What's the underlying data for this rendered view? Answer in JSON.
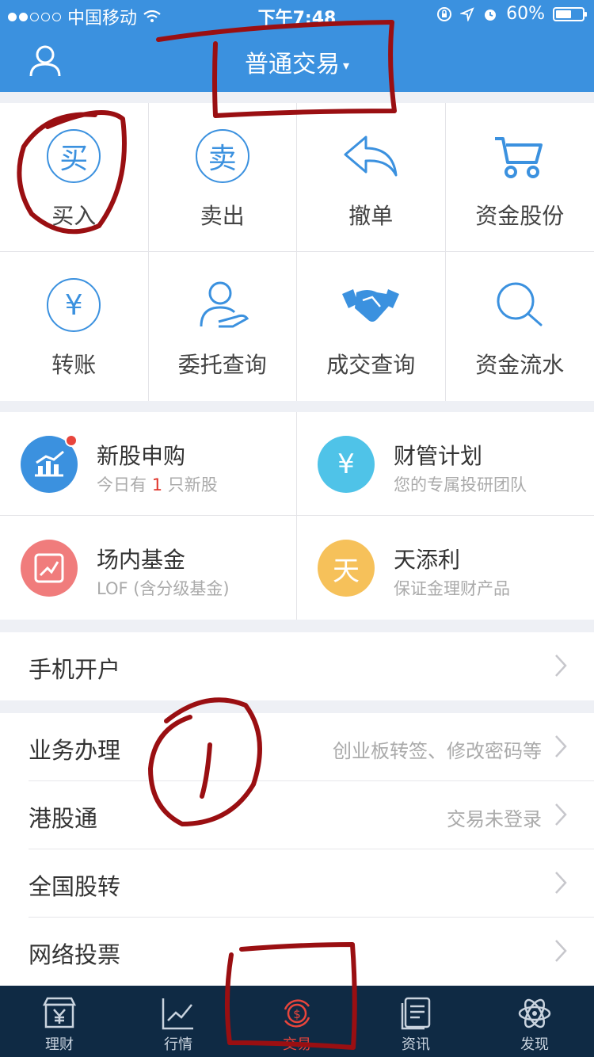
{
  "status_bar": {
    "carrier": "中国移动",
    "time": "下午7:48",
    "battery": "60%",
    "battery_level": 0.6
  },
  "nav": {
    "title": "普通交易",
    "caret": "▾"
  },
  "grid": [
    {
      "label": "买入",
      "icon": "buy-icon",
      "glyph": "买"
    },
    {
      "label": "卖出",
      "icon": "sell-icon",
      "glyph": "卖"
    },
    {
      "label": "撤单",
      "icon": "undo-icon"
    },
    {
      "label": "资金股份",
      "icon": "cart-icon"
    },
    {
      "label": "转账",
      "icon": "yuan-transfer-icon",
      "glyph": "¥"
    },
    {
      "label": "委托查询",
      "icon": "user-hand-icon"
    },
    {
      "label": "成交查询",
      "icon": "handshake-icon"
    },
    {
      "label": "资金流水",
      "icon": "search-icon"
    }
  ],
  "cards": [
    {
      "title": "新股申购",
      "sub_pre": "今日有 ",
      "sub_hl": "1",
      "sub_post": " 只新股",
      "icon": "chart-icon",
      "color": "#3b91df"
    },
    {
      "title": "财管计划",
      "sub": "您的专属投研团队",
      "icon": "yuan-box-icon",
      "color": "#4fc3e8",
      "glyph": "¥"
    },
    {
      "title": "场内基金",
      "sub": "LOF (含分级基金)",
      "icon": "trend-icon",
      "color": "#f07c7c"
    },
    {
      "title": "天添利",
      "sub": "保证金理财产品",
      "icon": "tian-icon",
      "color": "#f6c15a",
      "glyph": "天"
    }
  ],
  "list": [
    {
      "name": "手机开户",
      "value": ""
    },
    {
      "name": "业务办理",
      "value": "创业板转签、修改密码等"
    },
    {
      "name": "港股通",
      "value": "交易未登录"
    },
    {
      "name": "全国股转",
      "value": ""
    },
    {
      "name": "网络投票",
      "value": ""
    }
  ],
  "tabs": [
    {
      "label": "理财",
      "icon": "finance-icon",
      "active": false
    },
    {
      "label": "行情",
      "icon": "market-chart-icon",
      "active": false
    },
    {
      "label": "交易",
      "icon": "trade-icon",
      "active": true
    },
    {
      "label": "资讯",
      "icon": "news-icon",
      "active": false
    },
    {
      "label": "发现",
      "icon": "atom-icon",
      "active": false
    }
  ],
  "colors": {
    "primary": "#3b91df",
    "tabbar": "#0f2a44",
    "active_tab": "#e8453c",
    "annotation": "#9a0f12"
  }
}
